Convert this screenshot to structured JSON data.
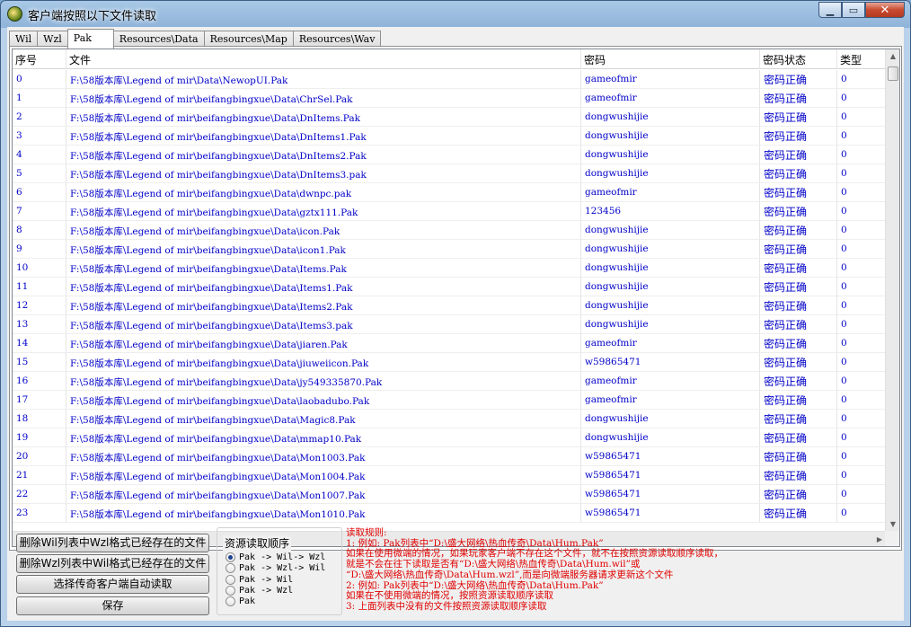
{
  "window": {
    "title": "客户端按照以下文件读取",
    "buttons": {
      "minimize": "▁",
      "maximize": "▭",
      "close": "✕"
    }
  },
  "tabs": [
    {
      "label": "Wil",
      "active": false
    },
    {
      "label": "Wzl",
      "active": false
    },
    {
      "label": "Pak",
      "active": true
    },
    {
      "label": "Resources\\Data",
      "active": false
    },
    {
      "label": "Resources\\Map",
      "active": false
    },
    {
      "label": "Resources\\Wav",
      "active": false
    }
  ],
  "table": {
    "columns": [
      "序号",
      "文件",
      "密码",
      "密码状态",
      "类型"
    ],
    "rows": [
      [
        "0",
        "F:\\58版本库\\Legend of mir\\Data\\NewopUI.Pak",
        "gameofmir",
        "密码正确",
        "0"
      ],
      [
        "1",
        "F:\\58版本库\\Legend of mir\\beifangbingxue\\Data\\ChrSel.Pak",
        "gameofmir",
        "密码正确",
        "0"
      ],
      [
        "2",
        "F:\\58版本库\\Legend of mir\\beifangbingxue\\Data\\DnItems.Pak",
        "dongwushijie",
        "密码正确",
        "0"
      ],
      [
        "3",
        "F:\\58版本库\\Legend of mir\\beifangbingxue\\Data\\DnItems1.Pak",
        "dongwushijie",
        "密码正确",
        "0"
      ],
      [
        "4",
        "F:\\58版本库\\Legend of mir\\beifangbingxue\\Data\\DnItems2.Pak",
        "dongwushijie",
        "密码正确",
        "0"
      ],
      [
        "5",
        "F:\\58版本库\\Legend of mir\\beifangbingxue\\Data\\DnItems3.pak",
        "dongwushijie",
        "密码正确",
        "0"
      ],
      [
        "6",
        "F:\\58版本库\\Legend of mir\\beifangbingxue\\Data\\dwnpc.pak",
        "gameofmir",
        "密码正确",
        "0"
      ],
      [
        "7",
        "F:\\58版本库\\Legend of mir\\beifangbingxue\\Data\\gztx111.Pak",
        "123456",
        "密码正确",
        "0"
      ],
      [
        "8",
        "F:\\58版本库\\Legend of mir\\beifangbingxue\\Data\\icon.Pak",
        "dongwushijie",
        "密码正确",
        "0"
      ],
      [
        "9",
        "F:\\58版本库\\Legend of mir\\beifangbingxue\\Data\\icon1.Pak",
        "dongwushijie",
        "密码正确",
        "0"
      ],
      [
        "10",
        "F:\\58版本库\\Legend of mir\\beifangbingxue\\Data\\Items.Pak",
        "dongwushijie",
        "密码正确",
        "0"
      ],
      [
        "11",
        "F:\\58版本库\\Legend of mir\\beifangbingxue\\Data\\Items1.Pak",
        "dongwushijie",
        "密码正确",
        "0"
      ],
      [
        "12",
        "F:\\58版本库\\Legend of mir\\beifangbingxue\\Data\\Items2.Pak",
        "dongwushijie",
        "密码正确",
        "0"
      ],
      [
        "13",
        "F:\\58版本库\\Legend of mir\\beifangbingxue\\Data\\Items3.pak",
        "dongwushijie",
        "密码正确",
        "0"
      ],
      [
        "14",
        "F:\\58版本库\\Legend of mir\\beifangbingxue\\Data\\jiaren.Pak",
        "gameofmir",
        "密码正确",
        "0"
      ],
      [
        "15",
        "F:\\58版本库\\Legend of mir\\beifangbingxue\\Data\\jiuweiicon.Pak",
        "w59865471",
        "密码正确",
        "0"
      ],
      [
        "16",
        "F:\\58版本库\\Legend of mir\\beifangbingxue\\Data\\jy549335870.Pak",
        "gameofmir",
        "密码正确",
        "0"
      ],
      [
        "17",
        "F:\\58版本库\\Legend of mir\\beifangbingxue\\Data\\laobadubo.Pak",
        "gameofmir",
        "密码正确",
        "0"
      ],
      [
        "18",
        "F:\\58版本库\\Legend of mir\\beifangbingxue\\Data\\Magic8.Pak",
        "dongwushijie",
        "密码正确",
        "0"
      ],
      [
        "19",
        "F:\\58版本库\\Legend of mir\\beifangbingxue\\Data\\mmap10.Pak",
        "dongwushijie",
        "密码正确",
        "0"
      ],
      [
        "20",
        "F:\\58版本库\\Legend of mir\\beifangbingxue\\Data\\Mon1003.Pak",
        "w59865471",
        "密码正确",
        "0"
      ],
      [
        "21",
        "F:\\58版本库\\Legend of mir\\beifangbingxue\\Data\\Mon1004.Pak",
        "w59865471",
        "密码正确",
        "0"
      ],
      [
        "22",
        "F:\\58版本库\\Legend of mir\\beifangbingxue\\Data\\Mon1007.Pak",
        "w59865471",
        "密码正确",
        "0"
      ],
      [
        "23",
        "F:\\58版本库\\Legend of mir\\beifangbingxue\\Data\\Mon1010.Pak",
        "w59865471",
        "密码正确",
        "0"
      ]
    ]
  },
  "buttons": {
    "delete_wil": "删除Wil列表中Wzl格式已经存在的文件",
    "delete_wzl": "删除Wzl列表中Wil格式已经存在的文件",
    "select_client": "选择传奇客户端自动读取",
    "save": "保存"
  },
  "read_order": {
    "title": "资源读取顺序",
    "options": [
      {
        "label": "Pak -> Wil-> Wzl",
        "selected": true
      },
      {
        "label": "Pak -> Wzl-> Wil",
        "selected": false
      },
      {
        "label": "Pak -> Wil",
        "selected": false
      },
      {
        "label": "Pak -> Wzl",
        "selected": false
      },
      {
        "label": "Pak",
        "selected": false
      }
    ]
  },
  "rules": {
    "lines": [
      "读取规则:",
      "1: 例如: Pak列表中“D:\\盛大网络\\热血传奇\\Data\\Hum.Pak”",
      "    如果在使用微端的情况，如果玩家客户端不存在这个文件，就不在按照资源读取顺序读取，",
      "    就是不会在往下读取是否有“D:\\盛大网络\\热血传奇\\Data\\Hum.wil”或",
      "    “D:\\盛大网络\\热血传奇\\Data\\Hum.wzl”,而是向微端服务器请求更新这个文件",
      "2: 例如: Pak列表中“D:\\盛大网络\\热血传奇\\Data\\Hum.Pak”",
      "    如果在不使用微端的情况，按照资源读取顺序读取",
      "3: 上面列表中没有的文件按照资源读取顺序读取"
    ]
  }
}
